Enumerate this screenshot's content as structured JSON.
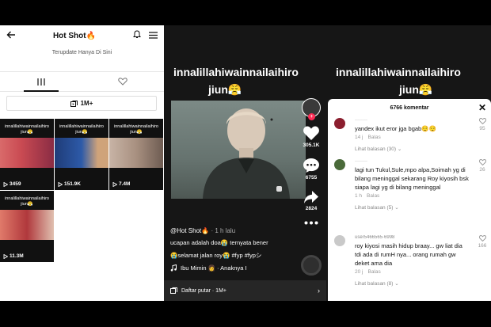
{
  "profile": {
    "title": "Hot Shot🔥",
    "subtitle": "Terupdate Hanya Di Sini",
    "playlist_label": "1M+",
    "tiles": [
      {
        "caption_top": "innalillahiwainnailaihiro",
        "caption_bottom": "jiun😤",
        "views": "3459",
        "thumb_color": "#c94a52"
      },
      {
        "caption_top": "innalillahiwainnailaihiro",
        "caption_bottom": "jiun😤",
        "views": "151.9K",
        "thumb_color": "#1f3c78"
      },
      {
        "caption_top": "innalillahiwainnailaihiro",
        "caption_bottom": "jiun😤",
        "views": "7.4M",
        "thumb_color": "#a89080"
      },
      {
        "caption_top": "innalillahiwainnailaihiro",
        "caption_bottom": "jiun😤",
        "views": "11.3M",
        "thumb_color": "#b0383c"
      }
    ]
  },
  "video": {
    "title_line1": "innalillahiwainnailaihiro",
    "title_line2": "jiun😤",
    "likes": "305.1K",
    "comments": "6755",
    "shares": "2824",
    "username": "@Hot Shot🔥",
    "time": "· 1 h lalu",
    "caption_line1": "ucapan adalah doa😭 ternyata bener",
    "caption_line2": "😭selamat jalan roy😭 #fyp #fypシ",
    "music": "Ibu Mimin 👩 · Anaknya I",
    "playlist_bar": "Daftar putar · 1M+"
  },
  "comments": {
    "title_line1": "innalillahiwainnailaihiro",
    "title_line2": "jiun😤",
    "header": "6766 komentar",
    "items": [
      {
        "username": "········",
        "text": "yandex ikut eror jga bgab😌😌",
        "age": "14 j",
        "reply": "Balas",
        "likes": "95",
        "more": "Lihat balasan (30) ⌄",
        "avatar_color": "#8b1e2e"
      },
      {
        "username": "········",
        "text": "lagi tun Tukul,Sule,mpo alpa,Soimah yg di bilang meninggal sekarang Roy kiyosih bsk siapa lagi yg di bilang meninggal",
        "age": "1 h",
        "reply": "Balas",
        "likes": "26",
        "more": "Lihat balasan (5) ⌄",
        "avatar_color": "#4a6a3a"
      },
      {
        "username": "user5466565·6998",
        "text": "roy kiyosi masih hidup braay... gw liat dia tdi ada di rumH nya... orang rumah gw deket ama dia",
        "age": "20 j",
        "reply": "Balas",
        "likes": "166",
        "more": "Lihat balasan (8) ⌄",
        "avatar_color": "#c9c9c9"
      }
    ]
  }
}
